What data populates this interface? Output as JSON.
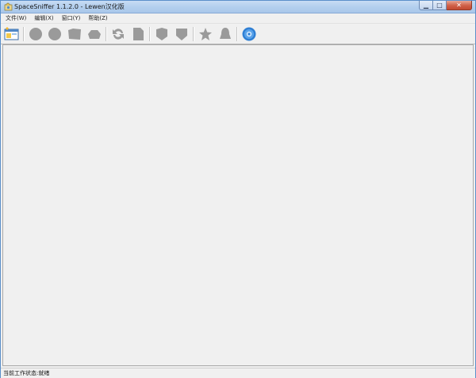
{
  "window": {
    "title": "SpaceSniffer 1.1.2.0 - Lewen汉化版",
    "caption_buttons": {
      "minimize": "▁",
      "maximize": "□",
      "close": "✕"
    }
  },
  "menubar": {
    "items": [
      "文件(W)",
      "编辑(X)",
      "窗口(Y)",
      "帮助(Z)"
    ]
  },
  "toolbar": {
    "buttons": [
      {
        "icon": "new-scan-icon",
        "enabled": true
      },
      {
        "icon": "zoom-in-icon",
        "enabled": false
      },
      {
        "icon": "zoom-out-icon",
        "enabled": false
      },
      {
        "icon": "folder-icon",
        "enabled": false
      },
      {
        "icon": "drive-icon",
        "enabled": false
      },
      {
        "icon": "refresh-icon",
        "enabled": false
      },
      {
        "icon": "document-icon",
        "enabled": false
      },
      {
        "icon": "shield-icon",
        "enabled": false
      },
      {
        "icon": "shield-alt-icon",
        "enabled": false
      },
      {
        "icon": "star-icon",
        "enabled": false
      },
      {
        "icon": "bell-icon",
        "enabled": false
      },
      {
        "icon": "settings-gear-icon",
        "enabled": true
      }
    ],
    "disabled_color": "#9a9a9a",
    "accent_color": "#2f7fd4"
  },
  "statusbar": {
    "text": "当前工作状态:就绪"
  }
}
